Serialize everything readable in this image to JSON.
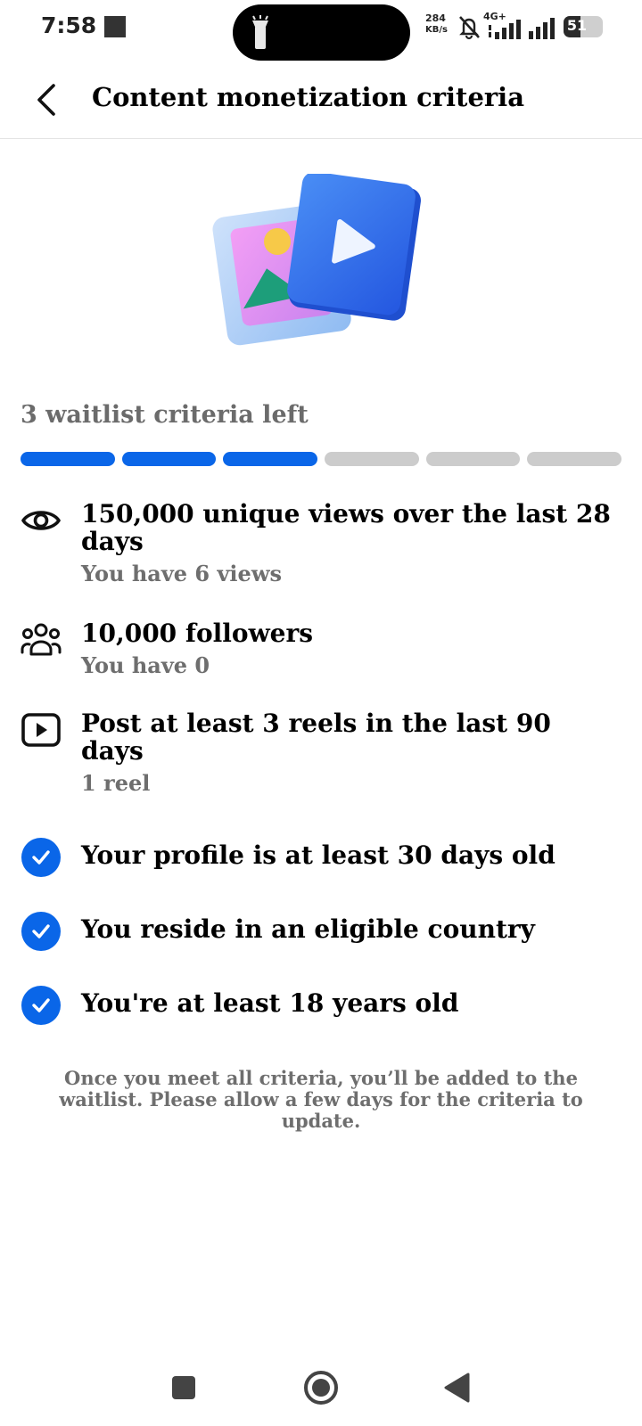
{
  "status_bar": {
    "time": "7:58",
    "net_speed_value": "284",
    "net_speed_unit": "KB/s",
    "net_type": "4G+",
    "battery_level": 51
  },
  "header": {
    "title": "Content monetization criteria",
    "back_icon": "chevron-left-icon"
  },
  "hero": {
    "photo_icon": "photo-card-icon",
    "video_icon": "play-card-icon",
    "colors": {
      "blue": "#2f6ff0",
      "light_blue": "#a7ccf7",
      "pink": "#e58ff0",
      "yellow": "#f7c948",
      "green": "#1d9e7a"
    }
  },
  "progress": {
    "label": "3 waitlist criteria left",
    "total_segments": 6,
    "completed_segments": 3,
    "accent": "#0a66e8",
    "track": "#cccccc"
  },
  "criteria": [
    {
      "icon": "eye-icon",
      "title": "150,000 unique views over the last 28 days",
      "subtitle": "You have 6 views",
      "met": false
    },
    {
      "icon": "followers-icon",
      "title": "10,000 followers",
      "subtitle": "You have 0",
      "met": false
    },
    {
      "icon": "reels-icon",
      "title": "Post at least 3 reels in the last 90 days",
      "subtitle": "1 reel",
      "met": false
    },
    {
      "icon": "check-circle-icon",
      "title": "Your profile is at least 30 days old",
      "met": true
    },
    {
      "icon": "check-circle-icon",
      "title": "You reside in an eligible country",
      "met": true
    },
    {
      "icon": "check-circle-icon",
      "title": "You're at least 18 years old",
      "met": true
    }
  ],
  "footnote": "Once you meet all criteria, you’ll be added to the waitlist. Please allow a few days for the criteria to update.",
  "nav_bar": {
    "recents_icon": "square-icon",
    "home_icon": "circle-home-icon",
    "back_icon": "triangle-back-icon"
  }
}
